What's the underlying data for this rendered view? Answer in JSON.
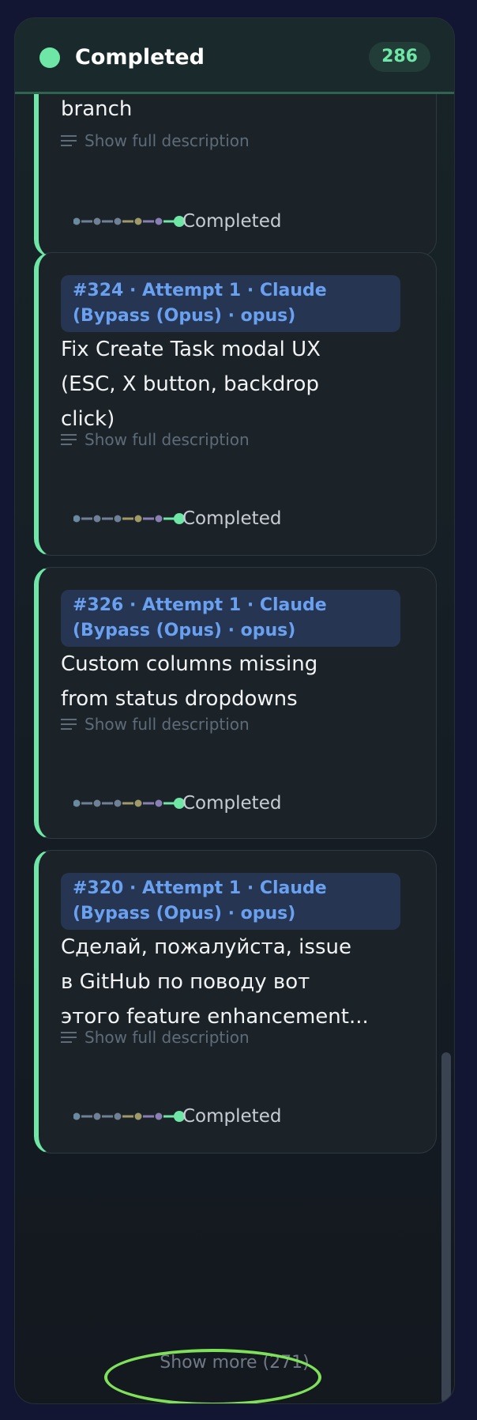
{
  "column": {
    "title": "Completed",
    "count": "286",
    "accent_color": "#6ee7a6",
    "show_more_label": "Show more (271)"
  },
  "cards": [
    {
      "meta": "",
      "title": "branch",
      "show_description": "Show full description",
      "status": "Completed"
    },
    {
      "meta": "#324 · Attempt 1 · Claude\n(Bypass (Opus) · opus)",
      "title": "Fix Create Task modal UX\n(ESC, X button, backdrop\nclick)",
      "show_description": "Show full description",
      "status": "Completed"
    },
    {
      "meta": "#326 · Attempt 1 · Claude\n(Bypass (Opus) · opus)",
      "title": "Custom columns missing\nfrom status dropdowns",
      "show_description": "Show full description",
      "status": "Completed"
    },
    {
      "meta": "#320 · Attempt 1 · Claude\n(Bypass (Opus) · opus)",
      "title": "Сделай, пожалуйста, issue\nв GitHub по поводу вот\nэтого feature enhancement...",
      "show_description": "Show full description",
      "status": "Completed"
    }
  ],
  "progress_steps": [
    "#6b8aa0",
    "#6f7f95",
    "#6f7f95",
    "#a09a68",
    "#8a7fb5",
    "#6ee7a6"
  ],
  "icons": {
    "status_dot": "status-dot-icon",
    "description": "lines-icon",
    "progress": "pipeline-progress-icon"
  }
}
